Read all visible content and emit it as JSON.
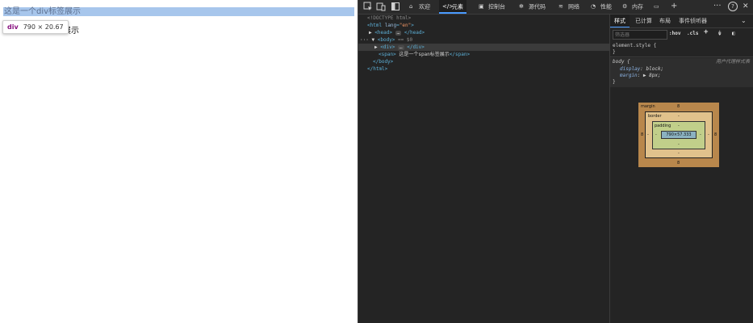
{
  "page": {
    "highlighted_div_text": "这是一个div标签展示",
    "span_text_visible": "签展示"
  },
  "tooltip": {
    "tag": "div",
    "size": "790 × 20.67"
  },
  "devtools": {
    "tabs": [
      {
        "label": "欢迎",
        "icon": "home-icon"
      },
      {
        "label": "元素",
        "icon": "code-icon",
        "active": true
      },
      {
        "label": "控制台",
        "icon": "console-icon"
      },
      {
        "label": "源代码",
        "icon": "bug-icon"
      },
      {
        "label": "网络",
        "icon": "wifi-icon"
      },
      {
        "label": "性能",
        "icon": "performance-icon"
      },
      {
        "label": "内存",
        "icon": "memory-icon"
      }
    ],
    "more": "···",
    "help": "?",
    "close": "✕",
    "add": "+",
    "dom": {
      "doctype": "<!DOCTYPE html>",
      "html_open_tag": "html",
      "html_attr_name": "lang",
      "html_attr_value": "\"en\"",
      "head_tag": "head",
      "head_close": "</head>",
      "body_tag": "body",
      "body_marker": "== $0",
      "div_tag": "div",
      "div_close": "</div>",
      "span_tag": "span",
      "span_text": "这是一个span标签展示",
      "span_close": "</span>",
      "body_close": "</body>",
      "html_close": "</html>",
      "ellipsis": "…"
    },
    "styles": {
      "sub_tabs": [
        "样式",
        "已计算",
        "布局",
        "事件侦听器"
      ],
      "filter_placeholder": "筛选器",
      "hov": ":hov",
      "cls": ".cls",
      "element_style": "element.style {",
      "close_brace": "}",
      "body_selector": "body {",
      "ua_label": "用户代理样式表",
      "props": [
        {
          "name": "display",
          "value": "block;"
        },
        {
          "name": "margin",
          "value": "▶ 8px;"
        }
      ]
    },
    "box_model": {
      "margin_label": "margin",
      "margin_top": "8",
      "margin_bottom": "8",
      "margin_left": "8",
      "margin_right": "8",
      "border_label": "border",
      "border_top": "-",
      "border_bottom": "-",
      "border_left": "-",
      "border_right": "-",
      "padding_label": "padding",
      "padding_top": "-",
      "padding_bottom": "-",
      "padding_left": "-",
      "padding_right": "-",
      "content": "790×57.333"
    },
    "colors": {
      "accent": "#4a9bff",
      "highlight": "#a7c6ec",
      "margin": "#b8874c",
      "border": "#e1c28c",
      "padding": "#c1cf8a",
      "content": "#8bb2c1"
    }
  }
}
